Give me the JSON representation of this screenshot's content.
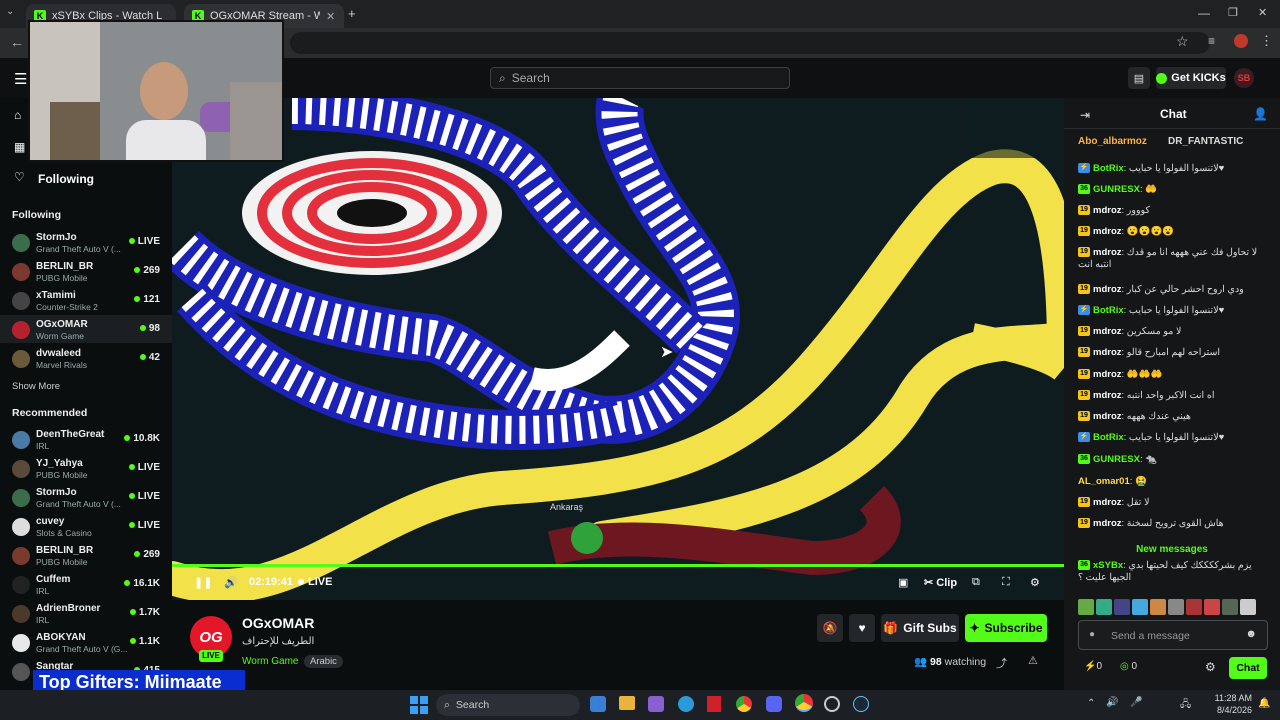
{
  "tabs": [
    {
      "label": "xSYBx Clips - Watch Live on Kick"
    },
    {
      "label": "OGxOMAR Stream - Watch"
    }
  ],
  "header": {
    "search_placeholder": "Search",
    "get_kicks_label": "Get KICKs"
  },
  "sidebar": {
    "following_title": "Following",
    "following_header": "Following",
    "following": [
      {
        "name": "StormJo",
        "category": "Grand Theft Auto V (...",
        "count": "LIVE"
      },
      {
        "name": "BERLIN_BR",
        "category": "PUBG Mobile",
        "count": "269"
      },
      {
        "name": "xTamimi",
        "category": "Counter-Strike 2",
        "count": "121"
      },
      {
        "name": "OGxOMAR",
        "category": "Worm Game",
        "count": "98"
      },
      {
        "name": "dvwaleed",
        "category": "Marvel Rivals",
        "count": "42"
      }
    ],
    "show_more": "Show More",
    "recommended_header": "Recommended",
    "recommended": [
      {
        "name": "DeenTheGreat",
        "category": "IRL",
        "count": "10.8K"
      },
      {
        "name": "YJ_Yahya",
        "category": "PUBG Mobile",
        "count": "LIVE"
      },
      {
        "name": "StormJo",
        "category": "Grand Theft Auto V (...",
        "count": "LIVE"
      },
      {
        "name": "cuvey",
        "category": "Slots & Casino",
        "count": "LIVE"
      },
      {
        "name": "BERLIN_BR",
        "category": "PUBG Mobile",
        "count": "269"
      },
      {
        "name": "Cuffem",
        "category": "IRL",
        "count": "16.1K"
      },
      {
        "name": "AdrienBroner",
        "category": "IRL",
        "count": "1.7K"
      },
      {
        "name": "ABOKYAN",
        "category": "Grand Theft Auto V (G...",
        "count": "1.1K"
      },
      {
        "name": "Sangtar",
        "category": "",
        "count": "415"
      }
    ]
  },
  "video": {
    "time": "02:19:41",
    "live_label": "LIVE",
    "clip_label": "Clip",
    "game_label": "Ankaraş"
  },
  "stream": {
    "channel": "OGxOMAR",
    "title": "الطريف للإحتراف",
    "category": "Worm Game",
    "language": "Arabic",
    "live_badge": "LIVE",
    "watching_count": "98",
    "watching_label": "watching",
    "gift_subs_label": "Gift Subs",
    "subscribe_label": "Subscribe"
  },
  "chat": {
    "title": "Chat",
    "pinned": [
      "Abo_albarmoz",
      "DR_FANTASTIC"
    ],
    "messages": [
      {
        "user": "BotRix",
        "text": "لاتنسوا الفولوا يا حبايب♥",
        "style": "bot"
      },
      {
        "user": "GUNRESX",
        "text": "🤲",
        "style": "green"
      },
      {
        "user": "mdroz",
        "text": "كووور",
        "style": "sub"
      },
      {
        "user": "mdroz",
        "text": "😮😮😮😮",
        "style": "sub"
      },
      {
        "user": "mdroz",
        "text": "لا تحاول فك عني هههه انا مو قدك انتبه انت",
        "style": "sub"
      },
      {
        "user": "mdroz",
        "text": "ودي اروح احشر حالي عن كبار",
        "style": "sub"
      },
      {
        "user": "BotRix",
        "text": "لاتنسوا الفولوا يا حبايب♥",
        "style": "bot"
      },
      {
        "user": "mdroz",
        "text": "لا مو مسكرين",
        "style": "sub"
      },
      {
        "user": "mdroz",
        "text": "استراحه لهم امبارح قالو",
        "style": "sub"
      },
      {
        "user": "mdroz",
        "text": "🤲🤲🤲",
        "style": "sub"
      },
      {
        "user": "mdroz",
        "text": "اه انت الاكبر واحد انتبه",
        "style": "sub"
      },
      {
        "user": "mdroz",
        "text": "هيني عندك هههه",
        "style": "sub"
      },
      {
        "user": "BotRix",
        "text": "لاتنسوا الفولوا يا حبايب♥",
        "style": "bot"
      },
      {
        "user": "GUNRESX",
        "text": "🐀",
        "style": "green"
      },
      {
        "user": "AL_omar01",
        "text": "🤮",
        "style": "plain"
      },
      {
        "user": "mdroz",
        "text": "لا تقل",
        "style": "sub"
      },
      {
        "user": "mdroz",
        "text": "هاش القوى ترويح لسخنة",
        "style": "sub"
      }
    ],
    "new_messages_label": "New messages",
    "last_message": {
      "user": "xSYBx",
      "text": "يزم بشرككككك كيف لحيتها بدي الجيها عليت ؟"
    },
    "input_placeholder": "Send a message",
    "kick_count": "0",
    "point_count": "0",
    "chat_button": "Chat"
  },
  "overlay": {
    "top_gifters": "Top Gifters: Miimaate"
  },
  "taskbar": {
    "search_label": "Search",
    "time": "11:28 AM",
    "date": "8/4/2026"
  }
}
